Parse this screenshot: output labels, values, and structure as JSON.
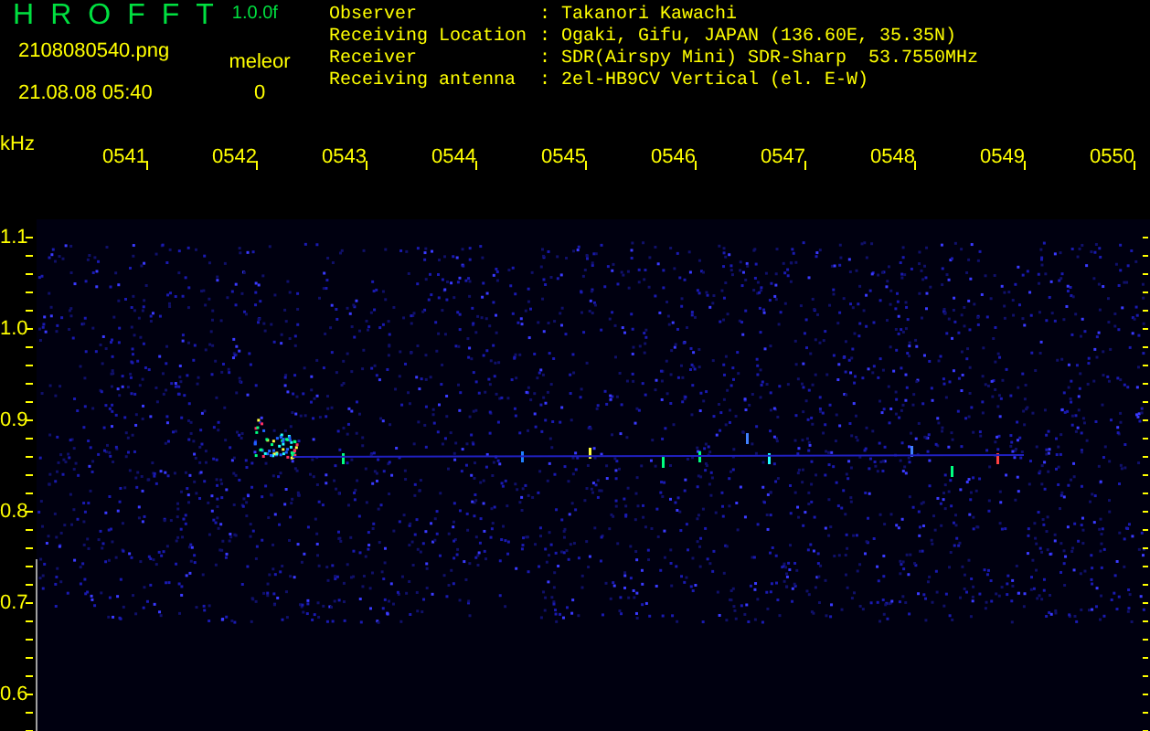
{
  "app": {
    "title_letters": [
      "H",
      "R",
      "O",
      "F",
      "F",
      "T"
    ],
    "version": "1.0.0f"
  },
  "file": {
    "name": "2108080540.png",
    "timestamp": "21.08.08 05:40"
  },
  "detection": {
    "label": "meleor",
    "count": "0"
  },
  "station": [
    {
      "label": "Observer",
      "separator": ":",
      "value": "Takanori Kawachi"
    },
    {
      "label": "Receiving Location",
      "separator": ":",
      "value": "Ogaki, Gifu, JAPAN (136.60E, 35.35N)"
    },
    {
      "label": "Receiver",
      "separator": ":",
      "value": "SDR(Airspy Mini) SDR-Sharp  53.7550MHz"
    },
    {
      "label": "Receiving antenna",
      "separator": ":",
      "value": "2el-HB9CV Vertical (el. E-W)"
    }
  ],
  "plot": {
    "unit": "kHz",
    "time_labels": [
      "0541",
      "0542",
      "0543",
      "0544",
      "0545",
      "0546",
      "0547",
      "0548",
      "0549",
      "0550"
    ],
    "frequency_labels": [
      "1.1",
      "1.0",
      "0.9",
      "0.8",
      "0.7",
      "0.6"
    ]
  }
}
